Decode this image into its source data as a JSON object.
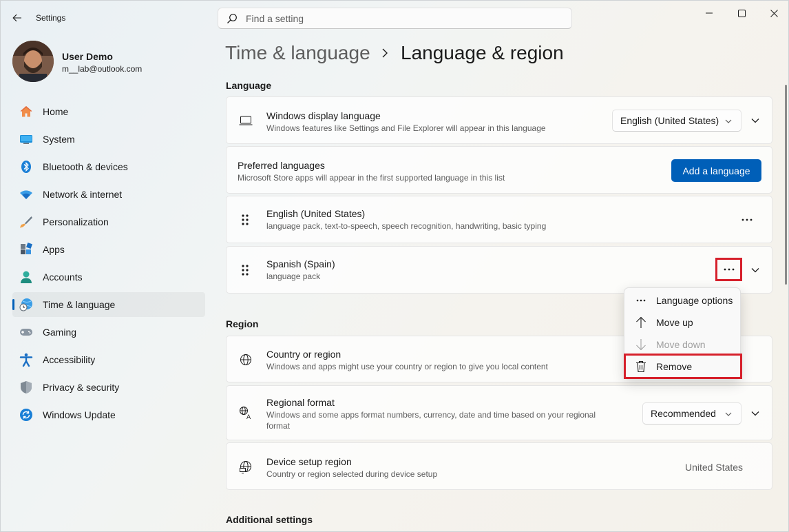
{
  "window": {
    "title": "Settings"
  },
  "search": {
    "placeholder": "Find a setting"
  },
  "user": {
    "name": "User Demo",
    "email": "m__lab@outlook.com"
  },
  "nav": {
    "items": [
      {
        "label": "Home",
        "icon": "home-icon"
      },
      {
        "label": "System",
        "icon": "system-icon"
      },
      {
        "label": "Bluetooth & devices",
        "icon": "bluetooth-icon"
      },
      {
        "label": "Network & internet",
        "icon": "wifi-icon"
      },
      {
        "label": "Personalization",
        "icon": "brush-icon"
      },
      {
        "label": "Apps",
        "icon": "apps-icon"
      },
      {
        "label": "Accounts",
        "icon": "accounts-icon"
      },
      {
        "label": "Time & language",
        "icon": "globe-clock-icon",
        "active": true
      },
      {
        "label": "Gaming",
        "icon": "gamepad-icon"
      },
      {
        "label": "Accessibility",
        "icon": "accessibility-icon"
      },
      {
        "label": "Privacy & security",
        "icon": "shield-icon"
      },
      {
        "label": "Windows Update",
        "icon": "update-icon"
      }
    ]
  },
  "breadcrumb": {
    "parent": "Time & language",
    "current": "Language & region"
  },
  "language_section": {
    "title": "Language",
    "display_language": {
      "title": "Windows display language",
      "desc": "Windows features like Settings and File Explorer will appear in this language",
      "value": "English (United States)"
    },
    "preferred": {
      "title": "Preferred languages",
      "desc": "Microsoft Store apps will appear in the first supported language in this list",
      "button": "Add a language"
    },
    "languages": [
      {
        "name": "English (United States)",
        "desc": "language pack, text-to-speech, speech recognition, handwriting, basic typing"
      },
      {
        "name": "Spanish (Spain)",
        "desc": "language pack"
      }
    ]
  },
  "context_menu": {
    "items": [
      {
        "label": "Language options",
        "icon": "more-icon",
        "disabled": false
      },
      {
        "label": "Move up",
        "icon": "arrow-up-icon",
        "disabled": false
      },
      {
        "label": "Move down",
        "icon": "arrow-down-icon",
        "disabled": true
      },
      {
        "label": "Remove",
        "icon": "trash-icon",
        "disabled": false
      }
    ]
  },
  "region_section": {
    "title": "Region",
    "country": {
      "title": "Country or region",
      "desc": "Windows and apps might use your country or region to give you local content"
    },
    "format": {
      "title": "Regional format",
      "desc": "Windows and some apps format numbers, currency, date and time based on your regional format",
      "value": "Recommended"
    },
    "device_region": {
      "title": "Device setup region",
      "desc": "Country or region selected during device setup",
      "value": "United States"
    }
  },
  "additional_section": {
    "title": "Additional settings"
  },
  "colors": {
    "accent": "#005fb8",
    "highlight": "#d6202b"
  }
}
